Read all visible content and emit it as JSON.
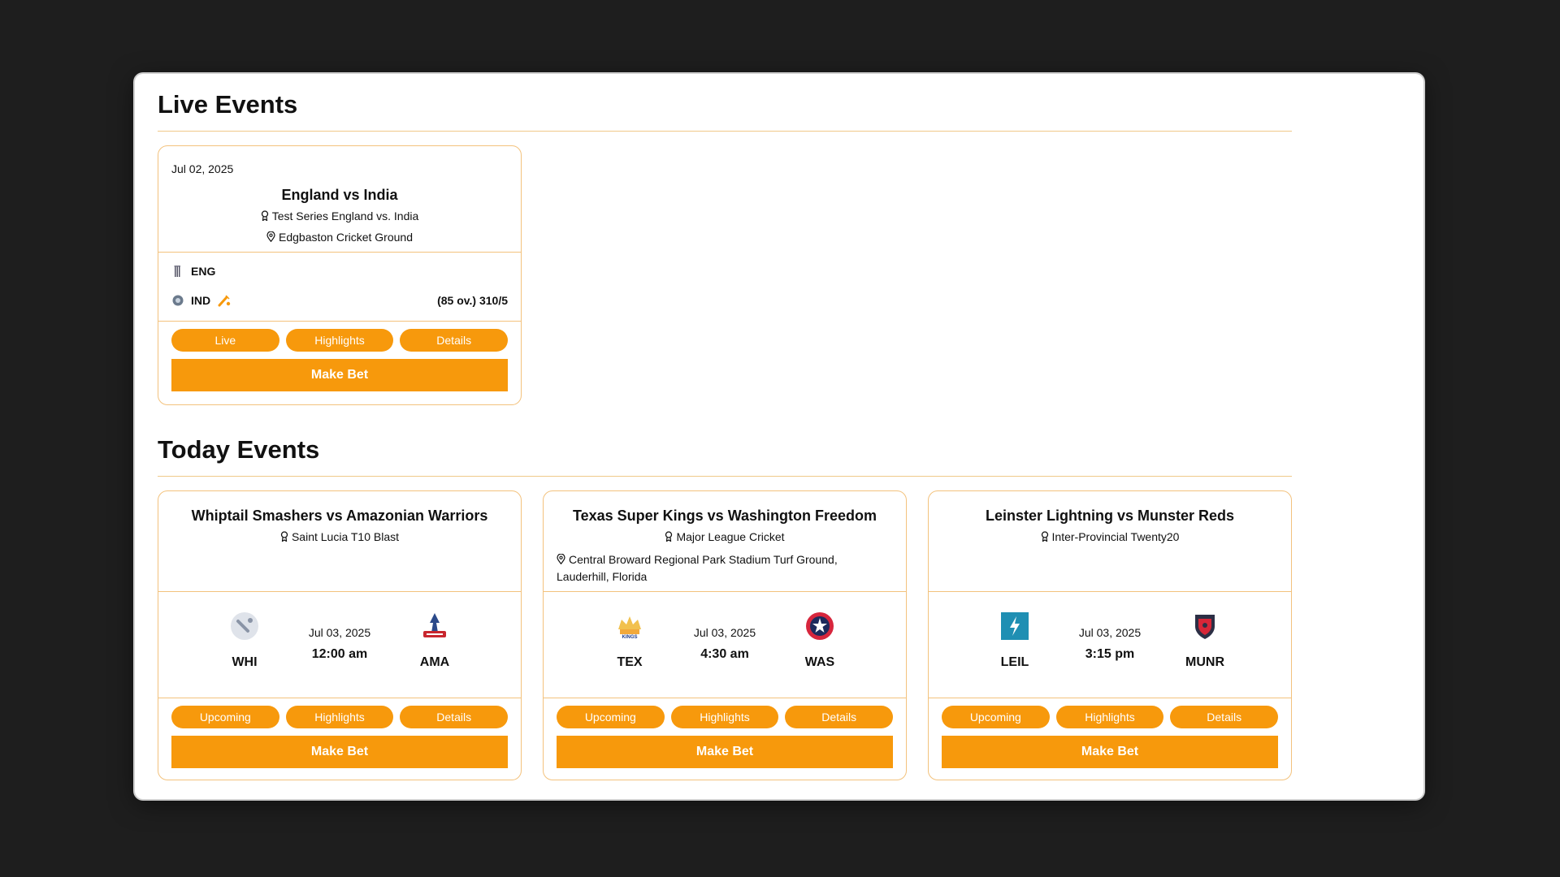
{
  "live_section": {
    "title": "Live Events",
    "card": {
      "date": "Jul 02, 2025",
      "title": "England vs India",
      "series": "Test Series England vs. India",
      "venue": "Edgbaston Cricket Ground",
      "team1": "ENG",
      "team2": "IND",
      "score": "(85 ov.) 310/5",
      "buttons": [
        "Live",
        "Highlights",
        "Details"
      ],
      "bet_label": "Make Bet"
    }
  },
  "today_section": {
    "title": "Today Events",
    "cards": [
      {
        "title": "Whiptail Smashers vs Amazonian Warriors",
        "series": "Saint Lucia T10 Blast",
        "venue_line1": "",
        "venue_line2": "",
        "date": "Jul 03, 2025",
        "time": "12:00 am",
        "home": "WHI",
        "away": "AMA",
        "buttons": [
          "Upcoming",
          "Highlights",
          "Details"
        ],
        "bet_label": "Make Bet"
      },
      {
        "title": "Texas Super Kings vs Washington Freedom",
        "series": "Major League Cricket",
        "venue_line1": "Central Broward Regional Park Stadium Turf Ground,",
        "venue_line2": "Lauderhill, Florida",
        "date": "Jul 03, 2025",
        "time": "4:30 am",
        "home": "TEX",
        "away": "WAS",
        "buttons": [
          "Upcoming",
          "Highlights",
          "Details"
        ],
        "bet_label": "Make Bet"
      },
      {
        "title": "Leinster Lightning vs Munster Reds",
        "series": "Inter-Provincial Twenty20",
        "venue_line1": "",
        "venue_line2": "",
        "date": "Jul 03, 2025",
        "time": "3:15 pm",
        "home": "LEIL",
        "away": "MUNR",
        "buttons": [
          "Upcoming",
          "Highlights",
          "Details"
        ],
        "bet_label": "Make Bet"
      }
    ]
  },
  "colors": {
    "accent": "#f7990c",
    "border": "#f3c27d",
    "background": "#1e1e1e"
  }
}
